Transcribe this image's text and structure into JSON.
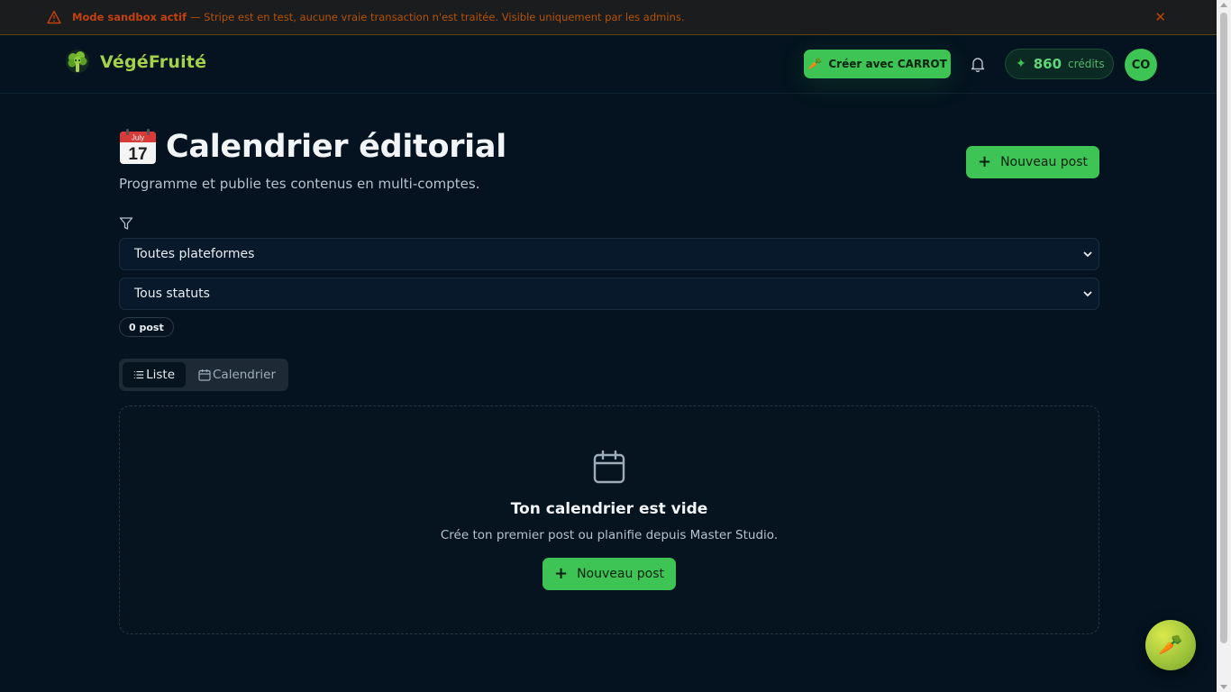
{
  "banner": {
    "strong": "Mode sandbox actif",
    "message": "— Stripe est en test, aucune vraie transaction n'est traitée. Visible uniquement par les admins.",
    "close": "✕"
  },
  "header": {
    "brand": "VégéFruité",
    "carrot_button": "Créer avec CARROT",
    "credits_value": "860",
    "credits_label": "crédits",
    "avatar_initials": "CO"
  },
  "page": {
    "title": "Calendrier éditorial",
    "subtitle": "Programme et publie tes contenus en multi-comptes.",
    "new_post": "Nouveau post"
  },
  "filters": {
    "platform": "Toutes plateformes",
    "status": "Tous statuts",
    "count": "0 post"
  },
  "tabs": [
    {
      "label": "Liste",
      "active": true
    },
    {
      "label": "Calendrier",
      "active": false
    }
  ],
  "empty": {
    "title": "Ton calendrier est vide",
    "description": "Crée ton premier post ou planifie depuis Master Studio.",
    "button": "Nouveau post"
  },
  "icons": {
    "calendar_emoji_month": "July",
    "calendar_emoji_day": "17"
  },
  "colors": {
    "accent": "#3ec455",
    "background": "#04131f",
    "warning": "#c2410c"
  }
}
